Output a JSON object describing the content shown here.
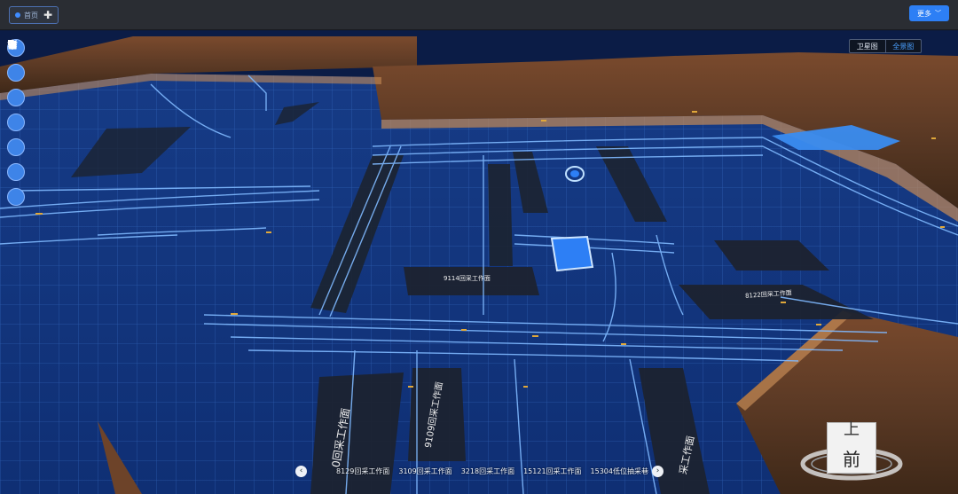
{
  "topbar": {
    "tab_label": "首页",
    "tab_add": "✚",
    "more_label": "更多",
    "more_icon": "chevron-down-icon"
  },
  "tools": [
    {
      "icon": "search-icon"
    },
    {
      "icon": "layers-icon"
    },
    {
      "icon": "tag-icon"
    },
    {
      "icon": "send-icon"
    },
    {
      "icon": "hand-pointer-icon"
    },
    {
      "icon": "tools-icon"
    },
    {
      "icon": "building-icon"
    }
  ],
  "view_toggle": {
    "satellite": "卫星图",
    "panorama": "全景图",
    "active": "panorama"
  },
  "map_labels": {
    "face_9114": "9114回采工作面",
    "face_8122": "8122回采工作面",
    "face_9109": "9109回采工作面",
    "face_partial_left": "0回采工作面",
    "face_partial_right": "采工作面"
  },
  "carousel": {
    "prev": "‹",
    "next": "›",
    "items": [
      "8129回采工作面",
      "3109回采工作面",
      "3218回采工作面",
      "15121回采工作面",
      "15304低位抽采巷"
    ]
  },
  "navcube": {
    "top": "上",
    "front": "前"
  },
  "colors": {
    "topbar": "#2a2d33",
    "accent": "#2d7ff5",
    "scene_bg": "#0d1b3d",
    "grid": "#2f63b8",
    "tunnel": "#7fb9ff",
    "panel": "#1c2330"
  }
}
